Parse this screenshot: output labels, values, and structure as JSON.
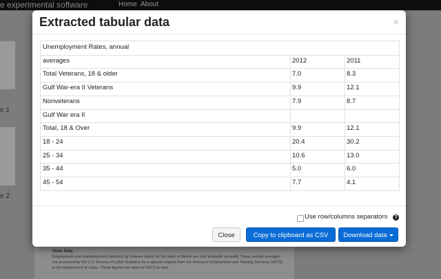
{
  "nav": {
    "brand": "e experimental software",
    "items": [
      "Home",
      "About"
    ]
  },
  "background": {
    "label_1": "e 1",
    "label_2": "e 2",
    "section_title": "State Data",
    "paragraph": "Employment and unemployment statistics by Veteran status for the state of Illinois are only available annually. These annual averages are produced by the U.S. Bureau of Labor Statistics for a special request from the Veteran's Employment and Training Services (VETS) in the Department of Labor. These figures are used by VETS in their"
  },
  "modal": {
    "title": "Extracted tabular data",
    "close_symbol": "×",
    "table": {
      "rows": [
        [
          "Unemployment Rates, annual",
          "",
          ""
        ],
        [
          "averages",
          "2012",
          "2011"
        ],
        [
          "Total Veterans, 18 & older",
          "7.0",
          "8.3"
        ],
        [
          "Gulf War-era II Veterans",
          "9.9",
          "12.1"
        ],
        [
          "Nonveterans",
          "7.9",
          "8.7"
        ],
        [
          "Gulf War era II",
          "",
          ""
        ],
        [
          "Total, 18 & Over",
          "9.9",
          "12.1"
        ],
        [
          "18 - 24",
          "20.4",
          "30.2"
        ],
        [
          "25 - 34",
          "10.6",
          "13.0"
        ],
        [
          "35 - 44",
          "5.0",
          "6.0"
        ],
        [
          "45 - 54",
          "7.7",
          "4.1"
        ]
      ]
    },
    "separator_checkbox": {
      "label": "Use row/columns separators",
      "checked": false
    },
    "help_symbol": "?",
    "buttons": {
      "close": "Close",
      "copy": "Copy to clipboard as CSV",
      "download": "Download data"
    }
  },
  "colors": {
    "primary": "#0a6cd6",
    "navbar": "#0e0e0e",
    "overlay": "#6a6a6a"
  }
}
